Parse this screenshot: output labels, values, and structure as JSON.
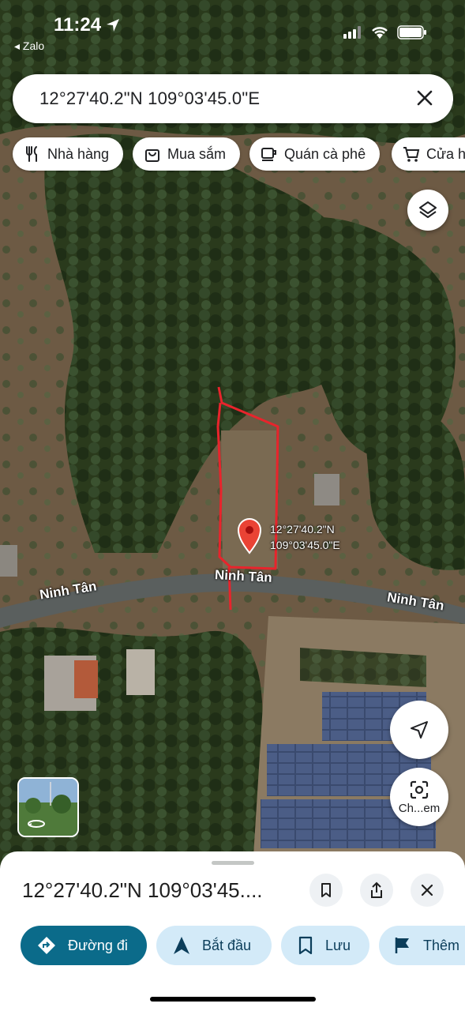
{
  "status_bar": {
    "time": "11:24",
    "back_app": "◂ Zalo"
  },
  "search": {
    "query": "12°27'40.2\"N 109°03'45.0\"E"
  },
  "chips": [
    {
      "label": "Nhà hàng",
      "icon": "fork-knife-icon"
    },
    {
      "label": "Mua sắm",
      "icon": "shopping-bag-icon"
    },
    {
      "label": "Quán cà phê",
      "icon": "coffee-cup-icon"
    },
    {
      "label": "Cửa h",
      "icon": "cart-icon"
    }
  ],
  "map": {
    "road_labels": [
      "Ninh Tân",
      "Ninh Tân",
      "Ninh Tân"
    ],
    "pin": {
      "lat": "12°27'40.2\"N",
      "lng": "109°03'45.0\"E",
      "color": "#ea4335"
    },
    "outline_color": "#e8242c",
    "street_view_button_label": "Ch...em"
  },
  "sheet": {
    "title": "12°27'40.2\"N 109°03'45....",
    "actions": [
      {
        "label": "Đường đi",
        "icon": "directions-icon",
        "primary": true
      },
      {
        "label": "Bắt đầu",
        "icon": "navigation-arrow-icon"
      },
      {
        "label": "Lưu",
        "icon": "bookmark-icon"
      },
      {
        "label": "Thêm",
        "icon": "flag-icon"
      }
    ]
  }
}
